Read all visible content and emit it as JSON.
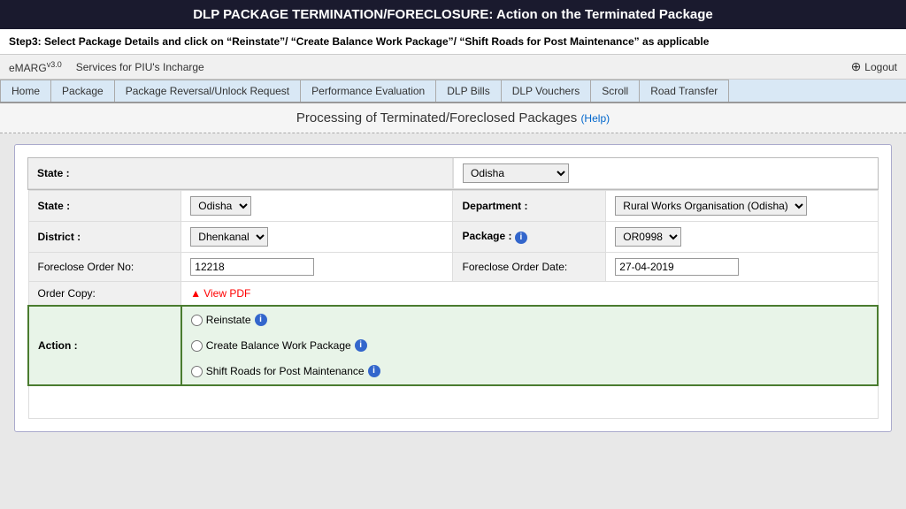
{
  "header": {
    "title": "DLP PACKAGE TERMINATION/FORECLOSURE: Action on the Terminated Package",
    "step": "Step3: Select Package Details and click on “Reinstate”/ “Create Balance Work Package”/ “Shift Roads for Post Maintenance” as applicable"
  },
  "topbar": {
    "app_name": "eMARG",
    "app_version": "v3.0",
    "service_label": "Services for PIU's Incharge",
    "logout_label": "Logout"
  },
  "nav": {
    "tabs": [
      {
        "id": "home",
        "label": "Home",
        "active": false
      },
      {
        "id": "package",
        "label": "Package",
        "active": false
      },
      {
        "id": "reversal",
        "label": "Package Reversal/Unlock Request",
        "active": false
      },
      {
        "id": "perf",
        "label": "Performance Evaluation",
        "active": false
      },
      {
        "id": "dlpbills",
        "label": "DLP Bills",
        "active": false
      },
      {
        "id": "dlpvouchers",
        "label": "DLP Vouchers",
        "active": false
      },
      {
        "id": "scroll",
        "label": "Scroll",
        "active": false
      },
      {
        "id": "roadtransfer",
        "label": "Road Transfer",
        "active": false
      }
    ]
  },
  "page": {
    "heading": "Processing of Terminated/Foreclosed Packages",
    "help_label": "(Help)"
  },
  "form": {
    "state_label": "State :",
    "state_value": "Odisha",
    "department_label": "Department :",
    "department_value": "Rural Works Organisation (Odisha)",
    "district_label": "District :",
    "district_value": "Dhenkanal",
    "package_label": "Package :",
    "package_value": "OR0998",
    "foreclosure_order_no_label": "Foreclose Order No:",
    "foreclosure_order_no_value": "12218",
    "foreclosure_order_date_label": "Foreclose Order Date:",
    "foreclosure_order_date_value": "27-04-2019",
    "order_copy_label": "Order Copy:",
    "view_pdf_label": "View PDF",
    "action_label": "Action :",
    "reinstate_label": "Reinstate",
    "create_balance_label": "Create Balance Work Package",
    "shift_roads_label": "Shift Roads for Post Maintenance"
  }
}
